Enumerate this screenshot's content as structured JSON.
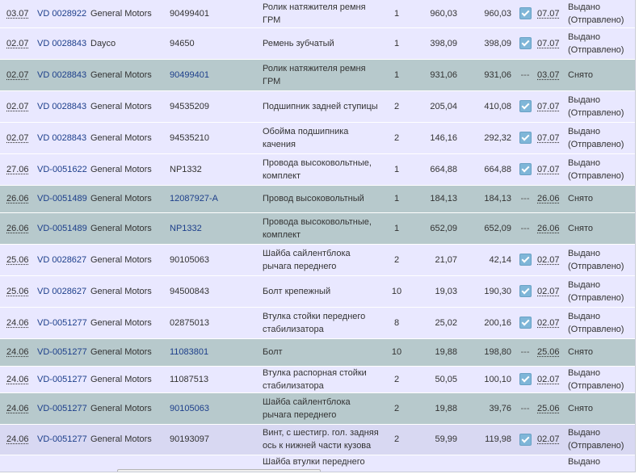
{
  "rows": [
    {
      "date": "03.07",
      "order": "VD 0028922",
      "brand": "General Motors",
      "part": "90499401",
      "part_link": false,
      "name": "Ролик натяжителя ремня ГРМ",
      "qty": "1",
      "price": "960,03",
      "sum": "960,03",
      "checked": true,
      "flag": "",
      "ship_date": "07.07",
      "status": "Выдано (Отправлено)",
      "style": "normal"
    },
    {
      "date": "02.07",
      "order": "VD 0028843",
      "brand": "Dayco",
      "part": "94650",
      "part_link": false,
      "name": "Ремень зубчатый",
      "qty": "1",
      "price": "398,09",
      "sum": "398,09",
      "checked": true,
      "flag": "",
      "ship_date": "07.07",
      "status": "Выдано (Отправлено)",
      "style": "normal"
    },
    {
      "date": "02.07",
      "order": "VD 0028843",
      "brand": "General Motors",
      "part": "90499401",
      "part_link": true,
      "name": "Ролик натяжителя ремня ГРМ",
      "qty": "1",
      "price": "931,06",
      "sum": "931,06",
      "checked": false,
      "flag": "---",
      "ship_date": "03.07",
      "status": "Снято",
      "style": "removed"
    },
    {
      "date": "02.07",
      "order": "VD 0028843",
      "brand": "General Motors",
      "part": "94535209",
      "part_link": false,
      "name": "Подшипник задней ступицы",
      "qty": "2",
      "price": "205,04",
      "sum": "410,08",
      "checked": true,
      "flag": "",
      "ship_date": "07.07",
      "status": "Выдано (Отправлено)",
      "style": "normal"
    },
    {
      "date": "02.07",
      "order": "VD 0028843",
      "brand": "General Motors",
      "part": "94535210",
      "part_link": false,
      "name": "Обойма подшипника качения",
      "qty": "2",
      "price": "146,16",
      "sum": "292,32",
      "checked": true,
      "flag": "",
      "ship_date": "07.07",
      "status": "Выдано (Отправлено)",
      "style": "normal"
    },
    {
      "date": "27.06",
      "order": "VD-0051622",
      "brand": "General Motors",
      "part": "NP1332",
      "part_link": false,
      "name": "Провода высоковольтные, комплект",
      "qty": "1",
      "price": "664,88",
      "sum": "664,88",
      "checked": true,
      "flag": "",
      "ship_date": "07.07",
      "status": "Выдано (Отправлено)",
      "style": "normal"
    },
    {
      "date": "26.06",
      "order": "VD-0051489",
      "brand": "General Motors",
      "part": "12087927-A",
      "part_link": true,
      "name": "Провод высоковольтный",
      "qty": "1",
      "price": "184,13",
      "sum": "184,13",
      "checked": false,
      "flag": "---",
      "ship_date": "26.06",
      "status": "Снято",
      "style": "removed"
    },
    {
      "date": "26.06",
      "order": "VD-0051489",
      "brand": "General Motors",
      "part": "NP1332",
      "part_link": true,
      "name": "Провода высоковольтные, комплект",
      "qty": "1",
      "price": "652,09",
      "sum": "652,09",
      "checked": false,
      "flag": "---",
      "ship_date": "26.06",
      "status": "Снято",
      "style": "removed"
    },
    {
      "date": "25.06",
      "order": "VD 0028627",
      "brand": "General Motors",
      "part": "90105063",
      "part_link": false,
      "name": "Шайба сайлентблока рычага переднего",
      "qty": "2",
      "price": "21,07",
      "sum": "42,14",
      "checked": true,
      "flag": "",
      "ship_date": "02.07",
      "status": "Выдано (Отправлено)",
      "style": "normal"
    },
    {
      "date": "25.06",
      "order": "VD 0028627",
      "brand": "General Motors",
      "part": "94500843",
      "part_link": false,
      "name": "Болт крепежный",
      "qty": "10",
      "price": "19,03",
      "sum": "190,30",
      "checked": true,
      "flag": "",
      "ship_date": "02.07",
      "status": "Выдано (Отправлено)",
      "style": "normal"
    },
    {
      "date": "24.06",
      "order": "VD-0051277",
      "brand": "General Motors",
      "part": "02875013",
      "part_link": false,
      "name": "Втулка стойки переднего стабилизатора",
      "qty": "8",
      "price": "25,02",
      "sum": "200,16",
      "checked": true,
      "flag": "",
      "ship_date": "02.07",
      "status": "Выдано (Отправлено)",
      "style": "normal"
    },
    {
      "date": "24.06",
      "order": "VD-0051277",
      "brand": "General Motors",
      "part": "11083801",
      "part_link": true,
      "name": "Болт",
      "qty": "10",
      "price": "19,88",
      "sum": "198,80",
      "checked": false,
      "flag": "---",
      "ship_date": "25.06",
      "status": "Снято",
      "style": "removed"
    },
    {
      "date": "24.06",
      "order": "VD-0051277",
      "brand": "General Motors",
      "part": "11087513",
      "part_link": false,
      "name": "Втулка распорная стойки стабилизатора",
      "qty": "2",
      "price": "50,05",
      "sum": "100,10",
      "checked": true,
      "flag": "",
      "ship_date": "02.07",
      "status": "Выдано (Отправлено)",
      "style": "normal"
    },
    {
      "date": "24.06",
      "order": "VD-0051277",
      "brand": "General Motors",
      "part": "90105063",
      "part_link": true,
      "name": "Шайба сайлентблока рычага переднего",
      "qty": "2",
      "price": "19,88",
      "sum": "39,76",
      "checked": false,
      "flag": "---",
      "ship_date": "25.06",
      "status": "Снято",
      "style": "removed"
    },
    {
      "date": "24.06",
      "order": "VD-0051277",
      "brand": "General Motors",
      "part": "90193097",
      "part_link": false,
      "name": "Винт, с шестигр. гол. задняя ось к нижней части кузова",
      "qty": "2",
      "price": "59,99",
      "sum": "119,98",
      "checked": true,
      "flag": "",
      "ship_date": "02.07",
      "status": "Выдано (Отправлено)",
      "style": "highlight"
    }
  ],
  "partial_row": {
    "name": "Шайба втулки переднего",
    "status": "Выдано"
  },
  "colors": {
    "normal_row": "#e9e8ff",
    "removed_row": "#b7c9cc",
    "link": "#1d3f8b",
    "check": "#7fb6d8"
  },
  "icons": {
    "checked": "checkbox-checked-icon"
  }
}
